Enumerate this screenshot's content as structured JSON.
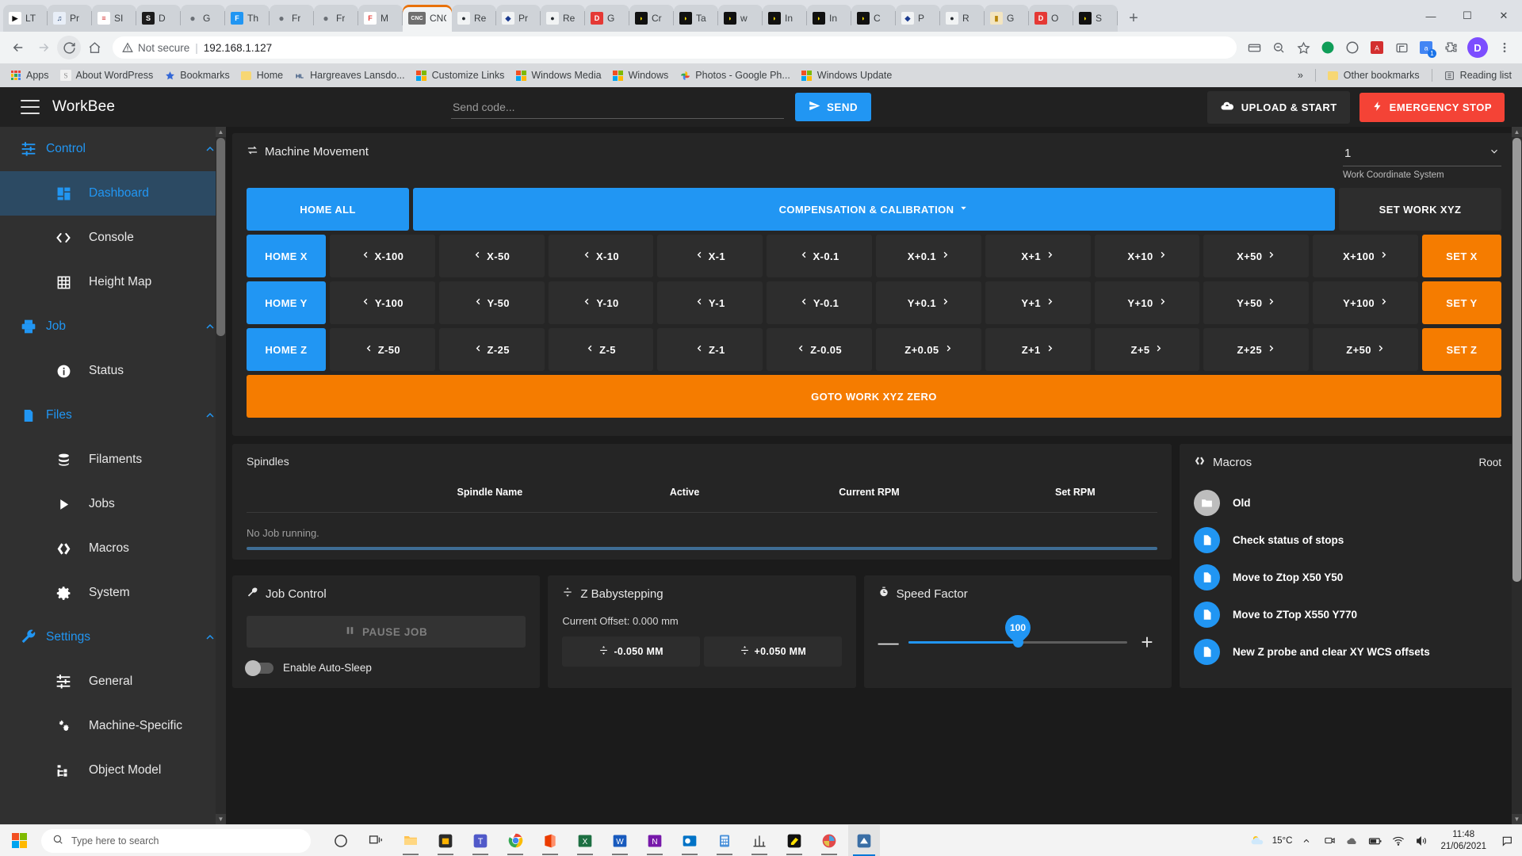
{
  "browser": {
    "tabs": [
      {
        "title": "LT",
        "favicon": "play-black",
        "active": false
      },
      {
        "title": "Pr",
        "favicon": "music-blue",
        "active": false
      },
      {
        "title": "SI",
        "favicon": "red-doc",
        "active": false
      },
      {
        "title": "D",
        "favicon": "s-black",
        "active": false
      },
      {
        "title": "G",
        "favicon": "globe-grey",
        "active": false
      },
      {
        "title": "Th",
        "favicon": "f-blue",
        "active": false
      },
      {
        "title": "Fr",
        "favicon": "globe-grey",
        "active": false
      },
      {
        "title": "Fr",
        "favicon": "globe-grey",
        "active": false
      },
      {
        "title": "M",
        "favicon": "f-gear-red",
        "active": false
      },
      {
        "title": "CNC",
        "favicon": "cnc-text",
        "active": true
      },
      {
        "title": "Re",
        "favicon": "github-black",
        "active": false
      },
      {
        "title": "Pr",
        "favicon": "drop-blue",
        "active": false
      },
      {
        "title": "Re",
        "favicon": "github-black",
        "active": false
      },
      {
        "title": "G",
        "favicon": "d-red",
        "active": false
      },
      {
        "title": "Cr",
        "favicon": "yellow-black",
        "active": false
      },
      {
        "title": "Ta",
        "favicon": "yellow-black",
        "active": false
      },
      {
        "title": "w",
        "favicon": "yellow-black",
        "active": false
      },
      {
        "title": "In",
        "favicon": "yellow-black",
        "active": false
      },
      {
        "title": "In",
        "favicon": "yellow-black",
        "active": false
      },
      {
        "title": "C",
        "favicon": "yellow-black",
        "active": false
      },
      {
        "title": "P",
        "favicon": "drop-blue",
        "active": false
      },
      {
        "title": "R",
        "favicon": "github-black",
        "active": false
      },
      {
        "title": "G",
        "favicon": "lock-gold",
        "active": false
      },
      {
        "title": "O",
        "favicon": "d-red",
        "active": false
      },
      {
        "title": "S",
        "favicon": "yellow-black",
        "active": false
      }
    ],
    "new_tab_label": "+",
    "window_controls": {
      "minimize": "—",
      "maximize": "❐",
      "close": "✕"
    },
    "url": "192.168.1.127",
    "security_text": "Not secure",
    "url_separator": "|",
    "profile_initial": "D",
    "extension_badge": "1",
    "bookmarks": [
      {
        "label": "Apps",
        "icon": "apps-grid-icon"
      },
      {
        "label": "About WordPress",
        "icon": "wordpress-icon"
      },
      {
        "label": "Bookmarks",
        "icon": "star-icon"
      },
      {
        "label": "Home",
        "icon": "folder-icon"
      },
      {
        "label": "Hargreaves Lansdo...",
        "icon": "hl-icon"
      },
      {
        "label": "Customize Links",
        "icon": "microsoft-icon"
      },
      {
        "label": "Windows Media",
        "icon": "microsoft-icon"
      },
      {
        "label": "Windows",
        "icon": "microsoft-icon"
      },
      {
        "label": "Photos - Google Ph...",
        "icon": "google-photos-icon"
      },
      {
        "label": "Windows Update",
        "icon": "microsoft-icon"
      }
    ],
    "overflow_label": "»",
    "other_bookmarks": "Other bookmarks",
    "reading_list": "Reading list"
  },
  "app": {
    "title": "WorkBee",
    "send_code_placeholder": "Send code...",
    "send_code_value": "",
    "send_label": "SEND",
    "upload_label": "UPLOAD & START",
    "emergency_label": "EMERGENCY STOP"
  },
  "sidebar": {
    "items": [
      {
        "label": "Control",
        "type": "group",
        "icon": "sliders-icon",
        "expanded": true
      },
      {
        "label": "Dashboard",
        "type": "item",
        "icon": "dashboard-icon",
        "active": true
      },
      {
        "label": "Console",
        "type": "item",
        "icon": "code-icon",
        "active": false
      },
      {
        "label": "Height Map",
        "type": "item",
        "icon": "grid-icon",
        "active": false
      },
      {
        "label": "Job",
        "type": "group",
        "icon": "printer-icon",
        "expanded": true
      },
      {
        "label": "Status",
        "type": "item",
        "icon": "info-icon",
        "active": false
      },
      {
        "label": "Files",
        "type": "group",
        "icon": "sdcard-icon",
        "expanded": true
      },
      {
        "label": "Filaments",
        "type": "item",
        "icon": "layers-icon",
        "active": false
      },
      {
        "label": "Jobs",
        "type": "item",
        "icon": "play-icon",
        "active": false
      },
      {
        "label": "Macros",
        "type": "item",
        "icon": "macros-icon",
        "active": false
      },
      {
        "label": "System",
        "type": "item",
        "icon": "gear-icon",
        "active": false
      },
      {
        "label": "Settings",
        "type": "group",
        "icon": "wrench-icon",
        "expanded": true
      },
      {
        "label": "General",
        "type": "item",
        "icon": "sliders-icon",
        "active": false
      },
      {
        "label": "Machine-Specific",
        "type": "item",
        "icon": "gears-icon",
        "active": false
      },
      {
        "label": "Object Model",
        "type": "item",
        "icon": "tree-icon",
        "active": false
      }
    ]
  },
  "machine_movement": {
    "title": "Machine Movement",
    "wcs_value": "1",
    "wcs_label": "Work Coordinate System",
    "home_all": "HOME ALL",
    "compensation": "COMPENSATION & CALIBRATION",
    "set_work_xyz": "SET WORK XYZ",
    "goto_work_zero": "GOTO WORK XYZ ZERO",
    "rows": [
      {
        "home": "HOME X",
        "set": "SET X",
        "buttons": [
          "X-100",
          "X-50",
          "X-10",
          "X-1",
          "X-0.1",
          "X+0.1",
          "X+1",
          "X+10",
          "X+50",
          "X+100"
        ]
      },
      {
        "home": "HOME Y",
        "set": "SET Y",
        "buttons": [
          "Y-100",
          "Y-50",
          "Y-10",
          "Y-1",
          "Y-0.1",
          "Y+0.1",
          "Y+1",
          "Y+10",
          "Y+50",
          "Y+100"
        ]
      },
      {
        "home": "HOME Z",
        "set": "SET Z",
        "buttons": [
          "Z-50",
          "Z-25",
          "Z-5",
          "Z-1",
          "Z-0.05",
          "Z+0.05",
          "Z+1",
          "Z+5",
          "Z+25",
          "Z+50"
        ]
      }
    ]
  },
  "spindles": {
    "title": "Spindles",
    "columns": [
      "Spindle Name",
      "Active",
      "Current RPM",
      "Set RPM"
    ],
    "rows": [],
    "status": "No Job running.",
    "progress": 100
  },
  "job_control": {
    "title": "Job Control",
    "pause_label": "PAUSE JOB",
    "autosleep_label": "Enable Auto-Sleep",
    "autosleep_on": false
  },
  "z_babystepping": {
    "title": "Z Babystepping",
    "offset_text": "Current Offset: 0.000 mm",
    "minus_label": "-0.050 MM",
    "plus_label": "+0.050 MM"
  },
  "speed_factor": {
    "title": "Speed Factor",
    "value": "100",
    "minus": "—",
    "plus": "+"
  },
  "macros": {
    "title": "Macros",
    "root_label": "Root",
    "items": [
      {
        "label": "Old",
        "type": "folder"
      },
      {
        "label": "Check status of stops",
        "type": "file"
      },
      {
        "label": "Move to Ztop X50 Y50",
        "type": "file"
      },
      {
        "label": "Move to ZTop X550 Y770",
        "type": "file"
      },
      {
        "label": "New Z probe and clear XY WCS offsets",
        "type": "file"
      }
    ]
  },
  "taskbar": {
    "search_placeholder": "Type here to search",
    "icons": [
      {
        "name": "cortana-icon"
      },
      {
        "name": "task-view-icon"
      },
      {
        "name": "file-explorer-icon"
      },
      {
        "name": "store-icon"
      },
      {
        "name": "teams-icon"
      },
      {
        "name": "chrome-icon"
      },
      {
        "name": "office-icon"
      },
      {
        "name": "excel-icon"
      },
      {
        "name": "word-icon"
      },
      {
        "name": "onenote-icon"
      },
      {
        "name": "outlook-icon"
      },
      {
        "name": "calculator-icon"
      },
      {
        "name": "chart-icon"
      },
      {
        "name": "highlighter-icon"
      },
      {
        "name": "paint3d-icon"
      },
      {
        "name": "printer3d-icon"
      }
    ],
    "weather": "15°C",
    "time": "11:48",
    "date": "21/06/2021"
  }
}
